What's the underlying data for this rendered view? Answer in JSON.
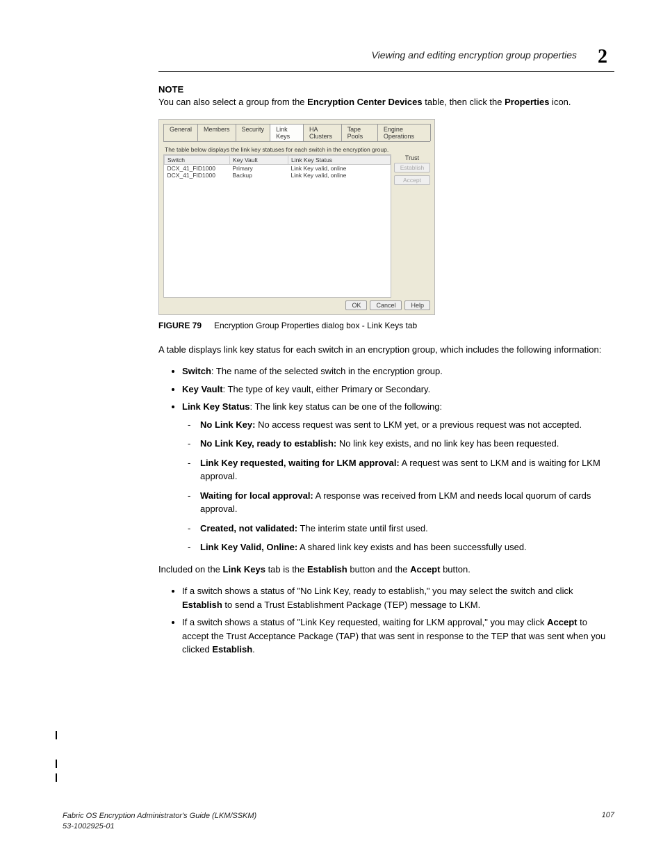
{
  "header": {
    "section_title": "Viewing and editing encryption group properties",
    "chapter_number": "2"
  },
  "note": {
    "label": "NOTE",
    "text_pre": "You can also select a group from the ",
    "text_bold1": "Encryption Center Devices",
    "text_mid": " table, then click the ",
    "text_bold2": "Properties",
    "text_post": " icon."
  },
  "dialog": {
    "tabs": [
      "General",
      "Members",
      "Security",
      "Link Keys",
      "HA Clusters",
      "Tape Pools",
      "Engine Operations"
    ],
    "active_tab_index": 3,
    "desc": "The table below displays the link key statuses for each switch in the encryption group.",
    "columns": [
      "Switch",
      "Key Vault",
      "Link Key Status"
    ],
    "rows": [
      {
        "switch": "DCX_41_FID1000",
        "vault": "Primary",
        "status": "Link Key valid, online"
      },
      {
        "switch": "DCX_41_FID1000",
        "vault": "Backup",
        "status": "Link Key valid, online"
      }
    ],
    "trust_label": "Trust",
    "btn_establish": "Establish",
    "btn_accept": "Accept",
    "btn_ok": "OK",
    "btn_cancel": "Cancel",
    "btn_help": "Help"
  },
  "figure": {
    "label": "FIGURE 79",
    "caption": "Encryption Group Properties dialog box - Link Keys tab"
  },
  "para1": "A table displays link key status for each switch in an encryption group, which includes the following information:",
  "bullets1": {
    "b1_bold": "Switch",
    "b1_text": ": The name of the selected switch in the encryption group.",
    "b2_bold": "Key Vault",
    "b2_text": ": The type of key vault, either Primary or Secondary.",
    "b3_bold": "Link Key Status",
    "b3_text": ": The link key status can be one of the following:"
  },
  "dashes": {
    "d1_bold": "No Link Key:",
    "d1_text": " No access request was sent to LKM yet, or a previous request was not accepted.",
    "d2_bold": "No Link Key, ready to establish:",
    "d2_text": " No link key exists, and no link key has been requested.",
    "d3_bold": "Link Key requested, waiting for LKM approval:",
    "d3_text": " A request was sent to LKM and is waiting for LKM approval.",
    "d4_bold": "Waiting for local approval:",
    "d4_text": " A response was received from LKM and needs local quorum of cards approval.",
    "d5_bold": "Created, not validated:",
    "d5_text": " The interim state until first used.",
    "d6_bold": "Link Key Valid, Online:",
    "d6_text": " A shared link key exists and has been successfully used."
  },
  "para2": {
    "pre": "Included on the ",
    "b1": "Link Keys",
    "mid1": " tab is the ",
    "b2": "Establish",
    "mid2": " button and the ",
    "b3": "Accept",
    "post": " button."
  },
  "bullets2": {
    "b1_pre": "If a switch shows a status of \"No Link Key, ready to establish,\" you may select the switch and click ",
    "b1_bold": "Establish",
    "b1_post": " to send a Trust Establishment Package (TEP) message to LKM.",
    "b2_pre": "If a switch shows a status of \"Link Key requested, waiting for LKM approval,\" you may click ",
    "b2_bold": "Accept",
    "b2_mid": " to accept the Trust Acceptance Package (TAP) that was sent in response to the TEP that was sent when you clicked ",
    "b2_bold2": "Establish",
    "b2_post": "."
  },
  "footer": {
    "title": "Fabric OS Encryption Administrator's Guide  (LKM/SSKM)",
    "docnum": "53-1002925-01",
    "page": "107"
  }
}
